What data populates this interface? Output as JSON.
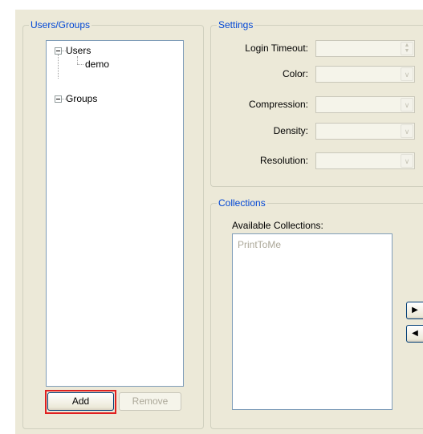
{
  "users_groups": {
    "title": "Users/Groups",
    "tree": {
      "users_label": "Users",
      "user_items": [
        "demo"
      ],
      "groups_label": "Groups"
    },
    "add_label": "Add",
    "remove_label": "Remove"
  },
  "settings": {
    "title": "Settings",
    "fields": {
      "login_timeout": {
        "label": "Login Timeout:",
        "value": ""
      },
      "color": {
        "label": "Color:",
        "value": ""
      },
      "compression": {
        "label": "Compression:",
        "value": ""
      },
      "density": {
        "label": "Density:",
        "value": ""
      },
      "resolution": {
        "label": "Resolution:",
        "value": ""
      }
    }
  },
  "collections": {
    "title": "Collections",
    "available_label": "Available Collections:",
    "available_items": [
      "PrintToMe"
    ]
  },
  "colors": {
    "groupbox_title": "#0046d5",
    "highlight": "#e02020",
    "disabled_text": "#aca899"
  }
}
